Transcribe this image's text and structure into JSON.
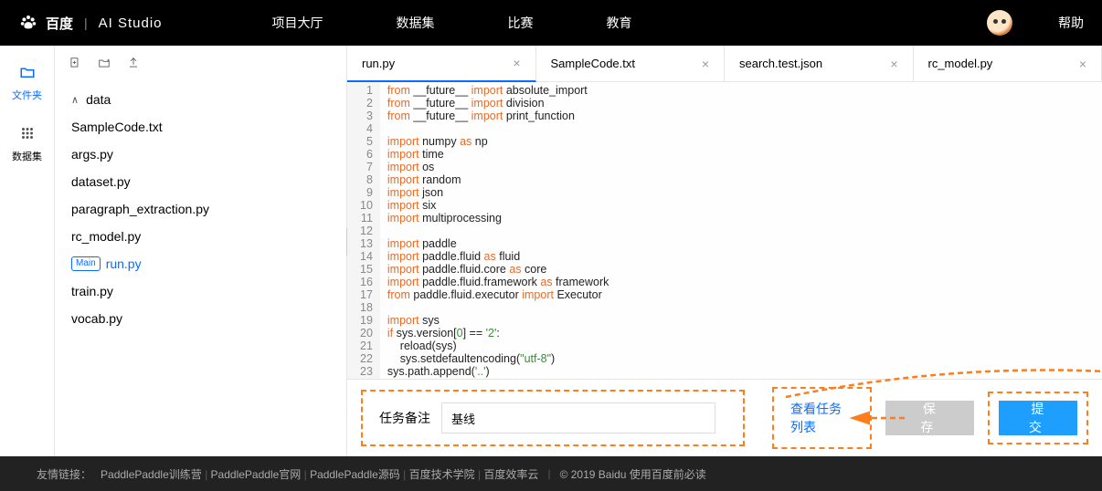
{
  "header": {
    "brand": "百度",
    "studio": "AI Studio",
    "nav": [
      "项目大厅",
      "数据集",
      "比赛",
      "教育"
    ],
    "help": "帮助"
  },
  "rail": {
    "files": "文件夹",
    "dataset": "数据集"
  },
  "tree": {
    "folder": "data",
    "items": [
      {
        "name": "SampleCode.txt"
      },
      {
        "name": "args.py"
      },
      {
        "name": "dataset.py"
      },
      {
        "name": "paragraph_extraction.py"
      },
      {
        "name": "rc_model.py"
      },
      {
        "name": "run.py",
        "main": true,
        "active": true
      },
      {
        "name": "train.py"
      },
      {
        "name": "vocab.py"
      }
    ],
    "main_badge": "Main"
  },
  "tabs": [
    {
      "label": "run.py",
      "active": true
    },
    {
      "label": "SampleCode.txt"
    },
    {
      "label": "search.test.json"
    },
    {
      "label": "rc_model.py"
    }
  ],
  "code": {
    "lines": [
      [
        {
          "t": "from ",
          "c": "kw"
        },
        {
          "t": "__future__ ",
          "c": "id"
        },
        {
          "t": "import ",
          "c": "kw"
        },
        {
          "t": "absolute_import",
          "c": "id"
        }
      ],
      [
        {
          "t": "from ",
          "c": "kw"
        },
        {
          "t": "__future__ ",
          "c": "id"
        },
        {
          "t": "import ",
          "c": "kw"
        },
        {
          "t": "division",
          "c": "id"
        }
      ],
      [
        {
          "t": "from ",
          "c": "kw"
        },
        {
          "t": "__future__ ",
          "c": "id"
        },
        {
          "t": "import ",
          "c": "kw"
        },
        {
          "t": "print_function",
          "c": "id"
        }
      ],
      [],
      [
        {
          "t": "import ",
          "c": "kw"
        },
        {
          "t": "numpy ",
          "c": "id"
        },
        {
          "t": "as ",
          "c": "kw"
        },
        {
          "t": "np",
          "c": "id"
        }
      ],
      [
        {
          "t": "import ",
          "c": "kw"
        },
        {
          "t": "time",
          "c": "id"
        }
      ],
      [
        {
          "t": "import ",
          "c": "kw"
        },
        {
          "t": "os",
          "c": "id"
        }
      ],
      [
        {
          "t": "import ",
          "c": "kw"
        },
        {
          "t": "random",
          "c": "id"
        }
      ],
      [
        {
          "t": "import ",
          "c": "kw"
        },
        {
          "t": "json",
          "c": "id"
        }
      ],
      [
        {
          "t": "import ",
          "c": "kw"
        },
        {
          "t": "six",
          "c": "id"
        }
      ],
      [
        {
          "t": "import ",
          "c": "kw"
        },
        {
          "t": "multiprocessing",
          "c": "id"
        }
      ],
      [],
      [
        {
          "t": "import ",
          "c": "kw"
        },
        {
          "t": "paddle",
          "c": "id"
        }
      ],
      [
        {
          "t": "import ",
          "c": "kw"
        },
        {
          "t": "paddle.fluid ",
          "c": "id"
        },
        {
          "t": "as ",
          "c": "kw"
        },
        {
          "t": "fluid",
          "c": "id"
        }
      ],
      [
        {
          "t": "import ",
          "c": "kw"
        },
        {
          "t": "paddle.fluid.core ",
          "c": "id"
        },
        {
          "t": "as ",
          "c": "kw"
        },
        {
          "t": "core",
          "c": "id"
        }
      ],
      [
        {
          "t": "import ",
          "c": "kw"
        },
        {
          "t": "paddle.fluid.framework ",
          "c": "id"
        },
        {
          "t": "as ",
          "c": "kw"
        },
        {
          "t": "framework",
          "c": "id"
        }
      ],
      [
        {
          "t": "from ",
          "c": "kw"
        },
        {
          "t": "paddle.fluid.executor ",
          "c": "id"
        },
        {
          "t": "import ",
          "c": "kw"
        },
        {
          "t": "Executor",
          "c": "id"
        }
      ],
      [],
      [
        {
          "t": "import ",
          "c": "kw"
        },
        {
          "t": "sys",
          "c": "id"
        }
      ],
      [
        {
          "t": "if ",
          "c": "kw"
        },
        {
          "t": "sys.version[",
          "c": "id"
        },
        {
          "t": "0",
          "c": "num"
        },
        {
          "t": "] == ",
          "c": "id"
        },
        {
          "t": "'2'",
          "c": "str"
        },
        {
          "t": ":",
          "c": "id"
        }
      ],
      [
        {
          "t": "    reload(sys)",
          "c": "id"
        }
      ],
      [
        {
          "t": "    sys.setdefaultencoding(",
          "c": "id"
        },
        {
          "t": "\"utf-8\"",
          "c": "str"
        },
        {
          "t": ")",
          "c": "id"
        }
      ],
      [
        {
          "t": "sys.path.append(",
          "c": "id"
        },
        {
          "t": "'..'",
          "c": "str"
        },
        {
          "t": ")",
          "c": "id"
        }
      ],
      []
    ]
  },
  "action": {
    "remark_label": "任务备注",
    "remark_value": "基线",
    "view_tasks": "查看任务列表",
    "save": "保存",
    "submit": "提交"
  },
  "footer": {
    "leading": "友情链接：",
    "links": [
      "PaddlePaddle训练营",
      "PaddlePaddle官网",
      "PaddlePaddle源码",
      "百度技术学院",
      "百度效率云"
    ],
    "copyright": "© 2019 Baidu 使用百度前必读"
  }
}
